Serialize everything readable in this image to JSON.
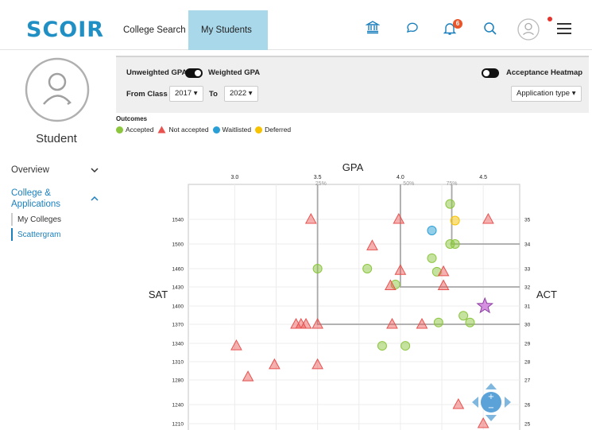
{
  "header": {
    "logo": "SCOIR",
    "nav_college_search": "College Search",
    "nav_my_students": "My Students",
    "notifications_count": "6"
  },
  "sidebar": {
    "student_name": "Student",
    "overview": "Overview",
    "college_applications_line1": "College &",
    "college_applications_line2": "Applications",
    "my_colleges": "My Colleges",
    "scattergram": "Scattergram"
  },
  "filters": {
    "unweighted_gpa": "Unweighted GPA",
    "weighted_gpa": "Weighted GPA",
    "acceptance_heatmap": "Acceptance Heatmap",
    "from_class_label": "From Class",
    "from_class_value": "2017",
    "to_label": "To",
    "to_value": "2022",
    "application_type": "Application type"
  },
  "outcomes": {
    "title": "Outcomes",
    "items": [
      {
        "label": "Accepted",
        "color": "#8cc63f",
        "shape": "circle"
      },
      {
        "label": "Not accepted",
        "color": "#e8524f",
        "shape": "triangle"
      },
      {
        "label": "Waitlisted",
        "color": "#2a9fd6",
        "shape": "circle"
      },
      {
        "label": "Deferred",
        "color": "#f7c200",
        "shape": "circle"
      }
    ]
  },
  "chart_data": {
    "type": "scatter",
    "title": "GPA",
    "y_left_label": "SAT",
    "y_right_label": "ACT",
    "x_ticks": [
      "3.0",
      "3.5",
      "4.0",
      "4.5"
    ],
    "percentile_labels": [
      "25%",
      "50%",
      "75%"
    ],
    "sat_ticks": [
      "1540",
      "1500",
      "1460",
      "1430",
      "1400",
      "1370",
      "1340",
      "1310",
      "1280",
      "1240",
      "1210"
    ],
    "act_ticks": [
      "35",
      "34",
      "33",
      "32",
      "31",
      "30",
      "29",
      "28",
      "27",
      "26",
      "25"
    ],
    "xlim": [
      2.72,
      4.72
    ],
    "grid": true,
    "series": [
      {
        "name": "Accepted",
        "color": "#8cc63f",
        "shape": "circle",
        "points": [
          [
            3.5,
            1460
          ],
          [
            3.8,
            1460
          ],
          [
            3.97,
            1434
          ],
          [
            4.3,
            1565
          ],
          [
            4.3,
            1500
          ],
          [
            4.33,
            1500
          ],
          [
            4.19,
            1477
          ],
          [
            4.22,
            1455
          ],
          [
            4.23,
            1373
          ],
          [
            4.38,
            1384
          ],
          [
            4.42,
            1373
          ],
          [
            3.89,
            1336
          ],
          [
            4.03,
            1336
          ]
        ]
      },
      {
        "name": "Not accepted",
        "color": "#e8524f",
        "shape": "triangle",
        "points": [
          [
            3.46,
            1540
          ],
          [
            3.99,
            1540
          ],
          [
            4.53,
            1540
          ],
          [
            3.83,
            1497
          ],
          [
            4.0,
            1457
          ],
          [
            4.26,
            1455
          ],
          [
            3.94,
            1432
          ],
          [
            4.26,
            1432
          ],
          [
            3.37,
            1370
          ],
          [
            3.4,
            1370
          ],
          [
            3.43,
            1370
          ],
          [
            3.5,
            1370
          ],
          [
            3.95,
            1370
          ],
          [
            4.13,
            1370
          ],
          [
            3.01,
            1336
          ],
          [
            3.24,
            1305
          ],
          [
            3.5,
            1305
          ],
          [
            3.08,
            1285
          ],
          [
            4.35,
            1240
          ],
          [
            4.5,
            1210
          ]
        ]
      },
      {
        "name": "Waitlisted",
        "color": "#2a9fd6",
        "shape": "circle",
        "points": [
          [
            4.19,
            1522
          ]
        ]
      },
      {
        "name": "Deferred",
        "color": "#f7c200",
        "shape": "circle",
        "points": [
          [
            4.33,
            1538
          ]
        ]
      }
    ],
    "student_marker": {
      "x": 4.51,
      "y": 1400,
      "color": "#c86dd7"
    }
  }
}
